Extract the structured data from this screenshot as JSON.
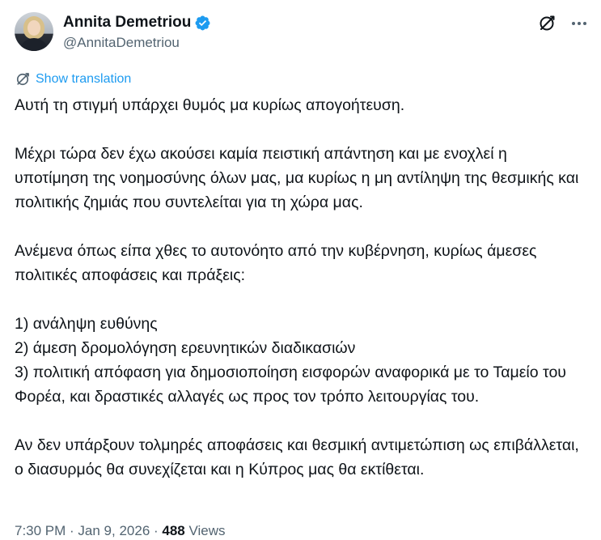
{
  "author": {
    "display_name": "Annita Demetriou",
    "handle": "@AnnitaDemetriou",
    "verified": true
  },
  "icons": {
    "verified": "verified-badge-icon",
    "translate": "translate-icon",
    "more": "more-icon",
    "globe": "globe-slash-icon"
  },
  "translation": {
    "label": "Show translation"
  },
  "tweet": {
    "paragraphs": [
      "Αυτή τη στιγμή υπάρχει θυμός μα κυρίως απογοήτευση.",
      "Μέχρι τώρα δεν έχω ακούσει καμία πειστική απάντηση και με ενοχλεί η υποτίμηση της νοημοσύνης όλων μας, μα κυρίως η μη αντίληψη της θεσμικής και πολιτικής ζημιάς που συντελείται για τη χώρα μας.",
      "Ανέμενα όπως είπα χθες το αυτονόητο από την κυβέρνηση, κυρίως άμεσες πολιτικές αποφάσεις και πράξεις:",
      "1) ανάληψη ευθύνης\n2) άμεση δρομολόγηση ερευνητικών διαδικασιών\n3) πολιτική απόφαση για δημοσιοποίηση εισφορών αναφορικά με το Ταμείο του Φορέα, και δραστικές αλλαγές ως προς τον τρόπο λειτουργίας του.",
      "Αν δεν υπάρξουν τολμηρές αποφάσεις και θεσμική αντιμετώπιση ως επιβάλλεται, ο διασυρμός θα συνεχίζεται και η Κύπρος μας θα εκτίθεται."
    ]
  },
  "meta": {
    "time": "7:30 PM",
    "date": "Jan 9, 2026",
    "separator": " · ",
    "views_count": "488",
    "views_label": "Views"
  },
  "colors": {
    "accent": "#1d9bf0",
    "text": "#0f1419",
    "secondary": "#536471"
  }
}
